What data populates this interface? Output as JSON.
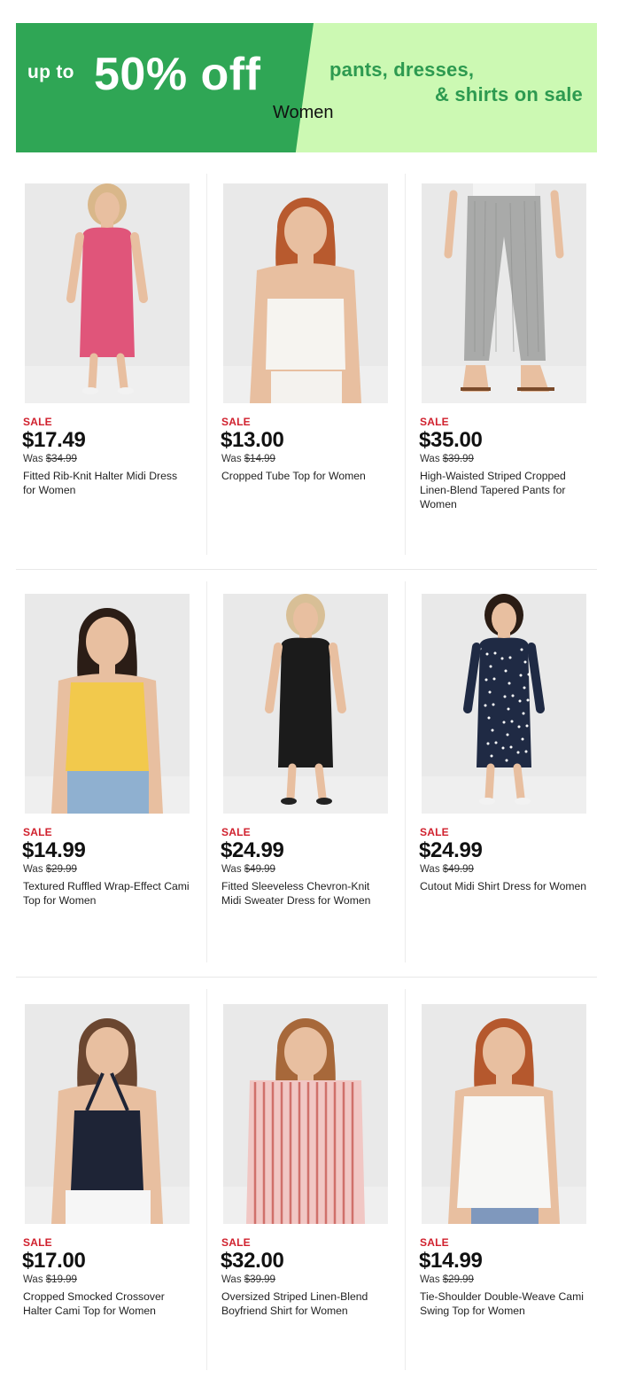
{
  "banner": {
    "up_to": "up to",
    "big": "50% off",
    "line1": "pants, dresses,",
    "line2": "& shirts on sale",
    "category": "Women"
  },
  "colors": {
    "banner_dark_green": "#2fa655",
    "banner_light_green": "#ccf9b3",
    "sale_red": "#d0202d"
  },
  "products": [
    {
      "sale": "SALE",
      "price": "$17.49",
      "was_label": "Was",
      "was": "$34.99",
      "name": "Fitted Rib-Knit Halter Midi Dress for Women",
      "garment": "pink-dress"
    },
    {
      "sale": "SALE",
      "price": "$13.00",
      "was_label": "Was",
      "was": "$14.99",
      "name": "Cropped Tube Top for Women",
      "garment": "white-tube"
    },
    {
      "sale": "SALE",
      "price": "$35.00",
      "was_label": "Was",
      "was": "$39.99",
      "name": "High-Waisted Striped Cropped Linen-Blend Tapered Pants for Women",
      "garment": "grey-pants"
    },
    {
      "sale": "SALE",
      "price": "$14.99",
      "was_label": "Was",
      "was": "$29.99",
      "name": "Textured Ruffled Wrap-Effect Cami Top for Women",
      "garment": "yellow-cami"
    },
    {
      "sale": "SALE",
      "price": "$24.99",
      "was_label": "Was",
      "was": "$49.99",
      "name": "Fitted Sleeveless Chevron-Knit Midi Sweater Dress for Women",
      "garment": "black-dress"
    },
    {
      "sale": "SALE",
      "price": "$24.99",
      "was_label": "Was",
      "was": "$49.99",
      "name": "Cutout Midi Shirt Dress for Women",
      "garment": "navy-dress"
    },
    {
      "sale": "SALE",
      "price": "$17.00",
      "was_label": "Was",
      "was": "$19.99",
      "name": "Cropped Smocked Crossover Halter Cami Top for Women",
      "garment": "navy-halter"
    },
    {
      "sale": "SALE",
      "price": "$32.00",
      "was_label": "Was",
      "was": "$39.99",
      "name": "Oversized Striped Linen-Blend Boyfriend Shirt for Women",
      "garment": "striped-shirt"
    },
    {
      "sale": "SALE",
      "price": "$14.99",
      "was_label": "Was",
      "was": "$29.99",
      "name": "Tie-Shoulder Double-Weave Cami Swing Top for Women",
      "garment": "white-cami"
    }
  ]
}
